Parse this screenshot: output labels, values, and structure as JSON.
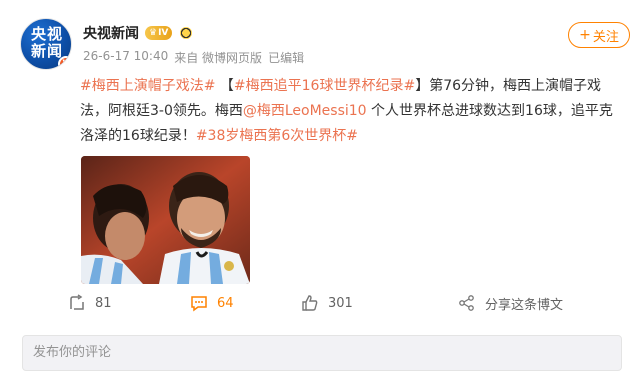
{
  "author": {
    "avatar_text_line1": "央视",
    "avatar_text_line2": "新闻",
    "avatar_badge": "V",
    "name": "央视新闻",
    "vip_level": "IV",
    "follow_label": "关注"
  },
  "meta": {
    "date": "26-6-17 10:40",
    "source": "来自 微博网页版",
    "edited": "已编辑"
  },
  "post": {
    "segments": [
      {
        "type": "hashtag",
        "text": "#梅西上演帽子戏法#"
      },
      {
        "type": "text",
        "text": " 【"
      },
      {
        "type": "hashtag",
        "text": "#梅西追平16球世界杯纪录#"
      },
      {
        "type": "text",
        "text": "】第76分钟，梅西上演帽子戏法，阿根廷3-0领先。梅西"
      },
      {
        "type": "mention",
        "text": "@梅西LeoMessi10"
      },
      {
        "type": "text",
        "text": " 个人世界杯总进球数达到16球，追平克洛泽的16球纪录！"
      },
      {
        "type": "hashtag",
        "text": "#38岁梅西第6次世界杯#"
      }
    ]
  },
  "stats": {
    "repost_count": "81",
    "comment_count": "64",
    "like_count": "301",
    "share_label": "分享这条博文"
  },
  "comment_box": {
    "placeholder": "发布你的评论"
  },
  "colors": {
    "accent": "#ff8200",
    "link": "#eb7350",
    "avatar_blue": "#0d4fa8"
  }
}
